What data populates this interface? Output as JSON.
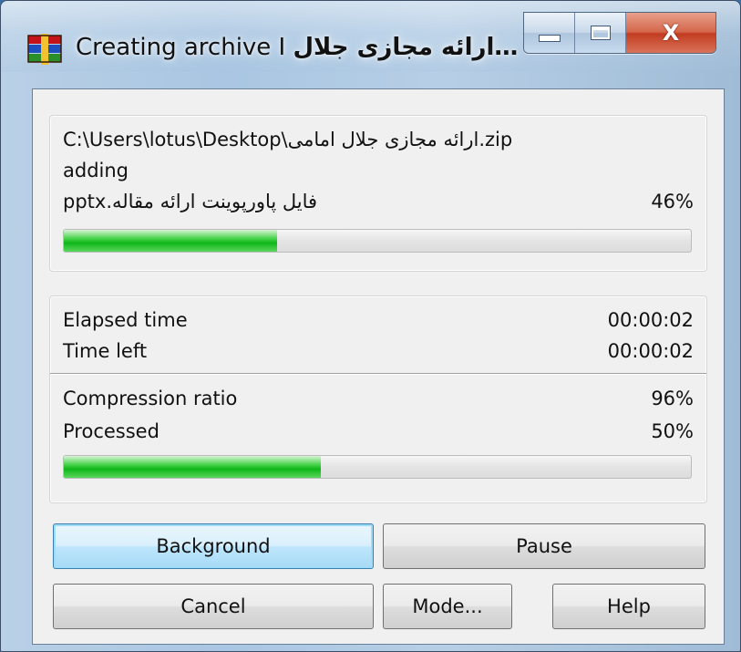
{
  "window": {
    "title": "…ارائه مجازی جلال I Creating archive",
    "title_left": "Creating archive I ",
    "title_right": "ارائه مجازی جلال…",
    "icon": "winrar-books-icon",
    "caption": {
      "minimize": "minimize-icon",
      "maximize": "maximize-icon",
      "close": "X"
    }
  },
  "archive": {
    "path": "C:\\Users\\lotus\\Desktop\\ارائه مجازی جلال امامی.zip",
    "action": "adding",
    "current_file": "فایل پاورپوینت ارائه مقاله.pptx",
    "file_percent": "46%",
    "file_progress": 0.34
  },
  "stats": {
    "elapsed_label": "Elapsed time",
    "elapsed_value": "00:00:02",
    "left_label": "Time left",
    "left_value": "00:00:02",
    "ratio_label": "Compression ratio",
    "ratio_value": "96%",
    "processed_label": "Processed",
    "processed_value": "50%",
    "total_progress": 0.41
  },
  "buttons": {
    "background": "Background",
    "pause": "Pause",
    "cancel": "Cancel",
    "mode": "Mode...",
    "help": "Help"
  },
  "colors": {
    "progress_fill": "#0fb61a",
    "default_button_border": "#3c7fb1",
    "close_button": "#c23c20"
  }
}
